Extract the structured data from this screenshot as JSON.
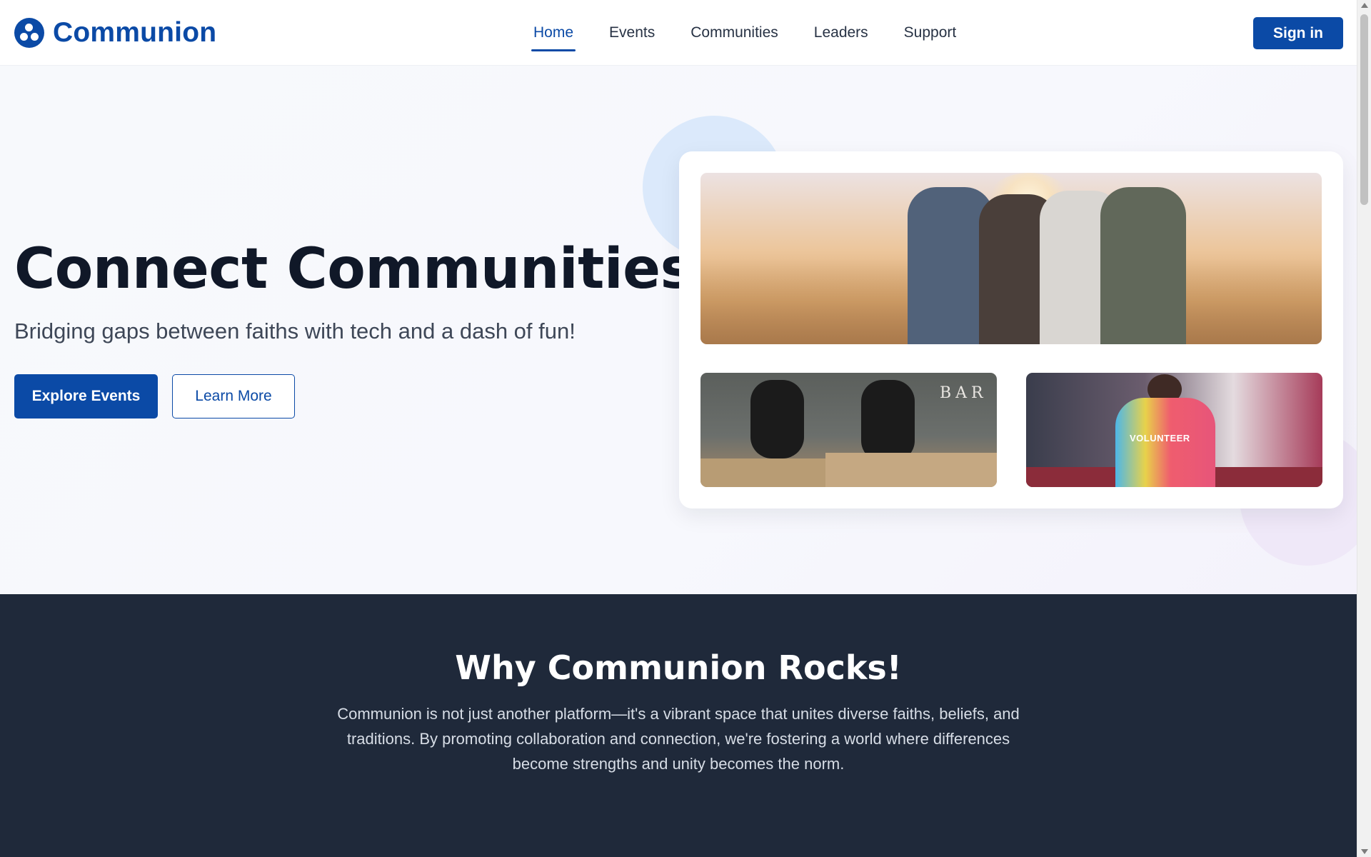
{
  "brand": {
    "name": "Communion",
    "logo_icon": "communion-logo-icon",
    "color": "#0b4aa6"
  },
  "nav": {
    "items": [
      {
        "label": "Home",
        "active": true
      },
      {
        "label": "Events",
        "active": false
      },
      {
        "label": "Communities",
        "active": false
      },
      {
        "label": "Leaders",
        "active": false
      },
      {
        "label": "Support",
        "active": false
      }
    ],
    "signin_label": "Sign in"
  },
  "hero": {
    "title": "Connect Communities",
    "subtitle": "Bridging gaps between faiths with tech and a dash of fun!",
    "primary_button": "Explore Events",
    "secondary_button": "Learn More",
    "images": [
      {
        "name": "friends-sunset-image"
      },
      {
        "name": "box-jump-gym-image",
        "sign_text": "BAR"
      },
      {
        "name": "volunteer-event-image",
        "shirt_text": "VOLUNTEER"
      }
    ]
  },
  "why": {
    "title": "Why Communion Rocks!",
    "text": "Communion is not just another platform—it's a vibrant space that unites diverse faiths, beliefs, and traditions. By promoting collaboration and connection, we're fostering a world where differences become strengths and unity becomes the norm."
  },
  "colors": {
    "primary": "#0b4aa6",
    "dark_section": "#1f293a",
    "hero_bg": "#f7f9fc"
  }
}
